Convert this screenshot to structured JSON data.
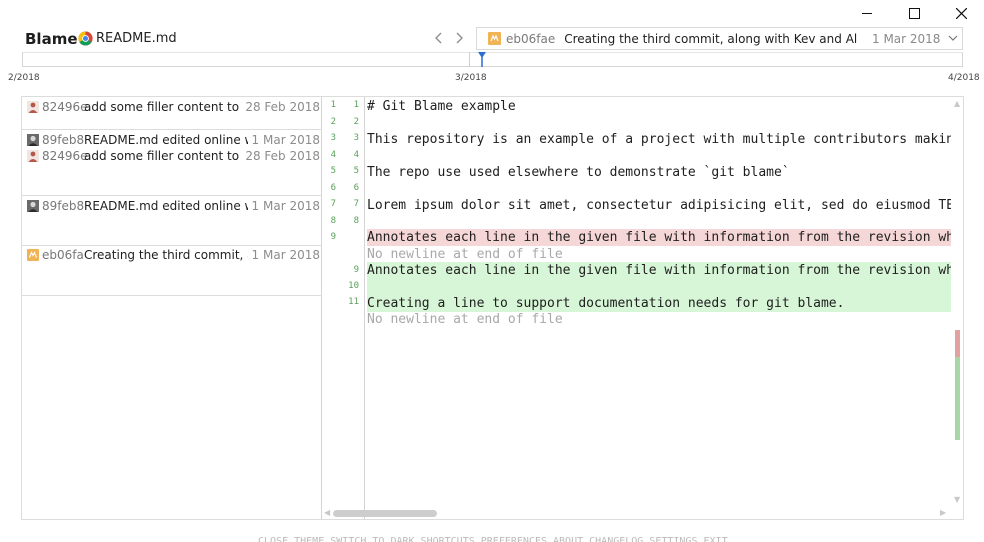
{
  "window": {
    "title": "Blame",
    "filename": "README.md",
    "icons": {
      "file": "chrome-icon",
      "minimize": "minimize-icon",
      "maximize": "maximize-icon",
      "close": "close-icon"
    }
  },
  "commit_selector": {
    "hash": "eb06fae",
    "message": "Creating the third commit, along with Kev and Al...",
    "date": "1 Mar 2018"
  },
  "timeline": {
    "labels": [
      "2/2018",
      "3/2018",
      "4/2018"
    ]
  },
  "blame": [
    {
      "hash": "82496e",
      "message": "add some filler content to the...",
      "date": "28 Feb 2018",
      "avatar_color": "#b5584a"
    },
    {
      "hash": "89feb8",
      "message": "README.md edited online with...",
      "date": "1 Mar 2018",
      "avatar_color": "#3a3a3a"
    },
    {
      "hash": "82496e",
      "message": "add some filler content to the...",
      "date": "28 Feb 2018",
      "avatar_color": "#b5584a"
    },
    {
      "hash": "89feb8",
      "message": "README.md edited online with...",
      "date": "1 Mar 2018",
      "avatar_color": "#3a3a3a"
    },
    {
      "hash": "eb06fa",
      "message": "Creating the third commit, alon...",
      "date": "1 Mar 2018",
      "avatar_color": "#f0b355"
    }
  ],
  "code_lines": [
    {
      "old": "1",
      "new": "1",
      "text": "# Git Blame example",
      "kind": "ctx"
    },
    {
      "old": "2",
      "new": "2",
      "text": "",
      "kind": "ctx"
    },
    {
      "old": "3",
      "new": "3",
      "text": "This repository is an example of a project with multiple contributors making commits.",
      "kind": "ctx"
    },
    {
      "old": "4",
      "new": "4",
      "text": "",
      "kind": "ctx"
    },
    {
      "old": "5",
      "new": "5",
      "text": "The repo use used elsewhere to demonstrate `git blame`",
      "kind": "ctx"
    },
    {
      "old": "6",
      "new": "6",
      "text": "",
      "kind": "ctx"
    },
    {
      "old": "7",
      "new": "7",
      "text": "Lorem ipsum dolor sit amet, consectetur adipisicing elit, sed do eiusmod TEMPOR incididunt",
      "kind": "ctx"
    },
    {
      "old": "8",
      "new": "8",
      "text": "",
      "kind": "ctx"
    },
    {
      "old": "9",
      "new": "",
      "text": "Annotates each line in the given file with information from the revision which last modified the line.",
      "kind": "del"
    },
    {
      "old": "",
      "new": "",
      "text": "No newline at end of file",
      "kind": "note"
    },
    {
      "old": "",
      "new": "9",
      "text": "Annotates each line in the given file with information from the revision which last modified the line.",
      "kind": "add"
    },
    {
      "old": "",
      "new": "10",
      "text": "",
      "kind": "add"
    },
    {
      "old": "",
      "new": "11",
      "text": "Creating a line to support documentation needs for git blame.",
      "kind": "add"
    },
    {
      "old": "",
      "new": "",
      "text": "No newline at end of file",
      "kind": "note"
    }
  ],
  "bottom_text": "CLOSE THEME SWITCH TO  DARK   SHORTCUTS  PREFERENCES  ABOUT   CHANGELOG  SETTINGS  EXIT"
}
